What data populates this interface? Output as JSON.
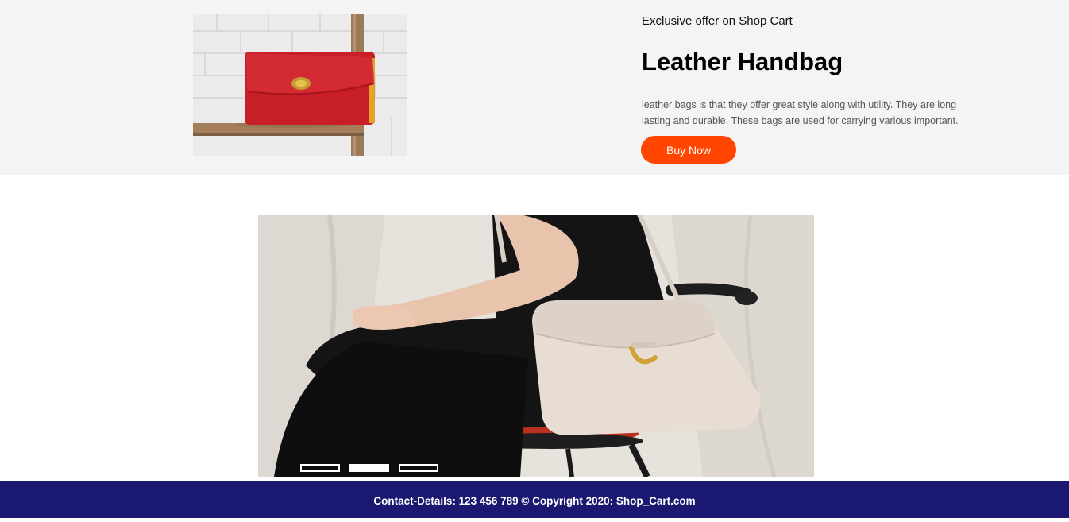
{
  "offer": {
    "eyebrow": "Exclusive offer on Shop Cart",
    "title": "Leather Handbag",
    "description": "leather bags is that they offer great style along with utility. They are long lasting and durable. These bags are used for carrying various important.",
    "button_label": "Buy Now",
    "button_color": "#ff4500",
    "background_color": "#f4f4f4",
    "image_icon": "red-leather-wallet-image"
  },
  "carousel": {
    "image_icon": "woman-with-beige-handbag-image",
    "active_slide": 2,
    "slide_count": 3
  },
  "footer": {
    "text": "Contact-Details: 123 456 789 © Copyright 2020:  Shop_Cart.com",
    "background_color": "#1a1870"
  }
}
